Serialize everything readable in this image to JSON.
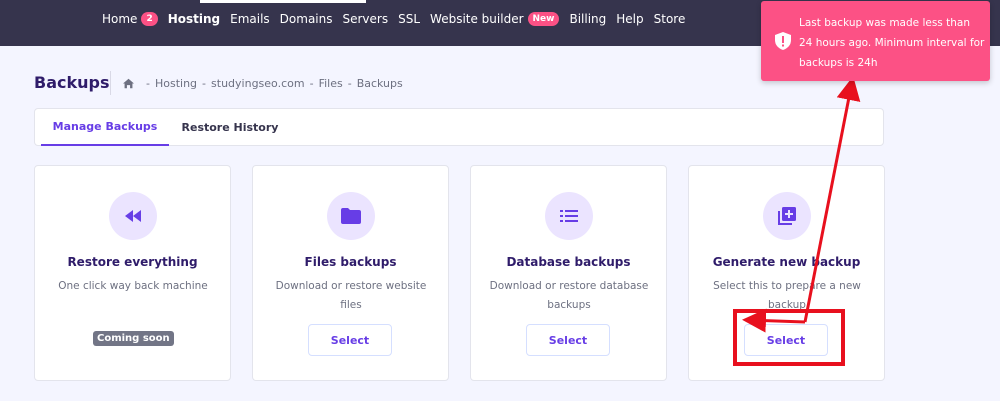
{
  "nav": {
    "items": [
      {
        "label": "Home",
        "badge": "2"
      },
      {
        "label": "Hosting"
      },
      {
        "label": "Emails"
      },
      {
        "label": "Domains"
      },
      {
        "label": "Servers"
      },
      {
        "label": "SSL"
      },
      {
        "label": "Website builder",
        "badge": "New"
      },
      {
        "label": "Billing"
      },
      {
        "label": "Help"
      },
      {
        "label": "Store"
      }
    ]
  },
  "page": {
    "title": "Backups",
    "breadcrumb": [
      "Hosting",
      "studyingseo.com",
      "Files",
      "Backups"
    ],
    "breadcrumb_separator": "-"
  },
  "tabs": [
    {
      "label": "Manage Backups",
      "active": true
    },
    {
      "label": "Restore History",
      "active": false
    }
  ],
  "cards": [
    {
      "title": "Restore everything",
      "description": "One click way back machine",
      "status": "Coming soon",
      "icon": "rewind-icon"
    },
    {
      "title": "Files backups",
      "description": "Download or restore website files",
      "button": "Select",
      "icon": "folder-icon"
    },
    {
      "title": "Database backups",
      "description": "Download or restore database backups",
      "button": "Select",
      "icon": "list-icon"
    },
    {
      "title": "Generate new backup",
      "description": "Select this to prepare a new backup",
      "button": "Select",
      "icon": "add-box-icon"
    }
  ],
  "toast": {
    "message": "Last backup was made less than 24 hours ago. Minimum interval for backups is 24h",
    "icon": "shield-alert-icon"
  },
  "colors": {
    "accent": "#673de6",
    "topbar": "#36344d",
    "toast": "#fc5185",
    "annotation": "#e8101e"
  }
}
